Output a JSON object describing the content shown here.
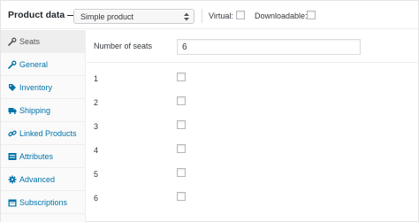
{
  "header": {
    "title": "Product data —",
    "product_type": "Simple product",
    "virtual_label": "Virtual:",
    "downloadable_label": "Downloadable:"
  },
  "sidebar": {
    "tabs": [
      {
        "label": "Seats",
        "icon": "wrench-icon",
        "active": true
      },
      {
        "label": "General",
        "icon": "wrench-icon"
      },
      {
        "label": "Inventory",
        "icon": "tag-icon"
      },
      {
        "label": "Shipping",
        "icon": "truck-icon"
      },
      {
        "label": "Linked Products",
        "icon": "link-icon"
      },
      {
        "label": "Attributes",
        "icon": "list-icon"
      },
      {
        "label": "Advanced",
        "icon": "gear-icon"
      },
      {
        "label": "Subscriptions",
        "icon": "calendar-icon"
      }
    ]
  },
  "seats": {
    "label": "Number of seats",
    "value": "6",
    "items": [
      "1",
      "2",
      "3",
      "4",
      "5",
      "6"
    ]
  },
  "colors": {
    "link": "#0073aa",
    "active_tab_bg": "#eeeeee"
  }
}
